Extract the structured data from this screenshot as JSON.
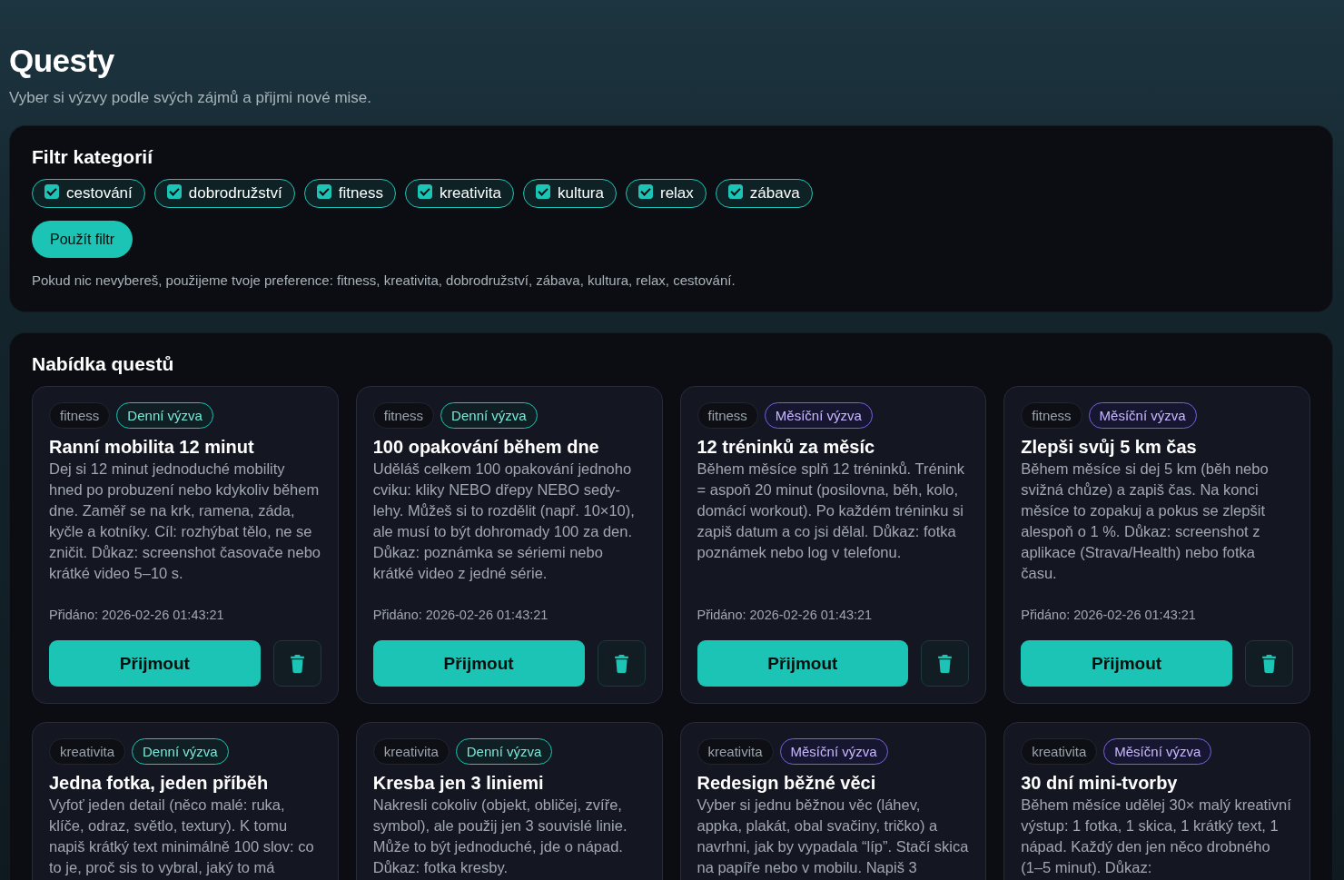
{
  "header": {
    "title": "Questy",
    "subtitle": "Vyber si výzvy podle svých zájmů a přijmi nové mise."
  },
  "filter": {
    "title": "Filtr kategorií",
    "categories": [
      {
        "label": "cestování",
        "checked": true
      },
      {
        "label": "dobrodružství",
        "checked": true
      },
      {
        "label": "fitness",
        "checked": true
      },
      {
        "label": "kreativita",
        "checked": true
      },
      {
        "label": "kultura",
        "checked": true
      },
      {
        "label": "relax",
        "checked": true
      },
      {
        "label": "zábava",
        "checked": true
      }
    ],
    "apply_button": "Použít filtr",
    "hint": "Pokud nic nevybereš, použijeme tvoje preference: fitness, kreativita, dobrodružství, zábava, kultura, relax, cestování."
  },
  "offers": {
    "title": "Nabídka questů",
    "quests": [
      {
        "category": "fitness",
        "type": {
          "label": "Denní výzva",
          "kind": "daily"
        },
        "title": "Ranní mobilita 12 minut",
        "description": "Dej si 12 minut jednoduché mobility hned po probuzení nebo kdykoliv během dne. Zaměř se na krk, ramena, záda, kyčle a kotníky. Cíl: rozhýbat tělo, ne se zničit. Důkaz: screenshot časovače nebo krátké video 5–10 s.",
        "added": "Přidáno: 2026-02-26 01:43:21",
        "accept": "Přijmout"
      },
      {
        "category": "fitness",
        "type": {
          "label": "Denní výzva",
          "kind": "daily"
        },
        "title": "100 opakování během dne",
        "description": "Uděláš celkem 100 opakování jednoho cviku: kliky NEBO dřepy NEBO sedy-lehy. Můžeš si to rozdělit (např. 10×10), ale musí to být dohromady 100 za den. Důkaz: poznámka se sériemi nebo krátké video z jedné série.",
        "added": "Přidáno: 2026-02-26 01:43:21",
        "accept": "Přijmout"
      },
      {
        "category": "fitness",
        "type": {
          "label": "Měsíční výzva",
          "kind": "monthly"
        },
        "title": "12 tréninků za měsíc",
        "description": "Během měsíce splň 12 tréninků. Trénink = aspoň 20 minut (posilovna, běh, kolo, domácí workout). Po každém tréninku si zapiš datum a co jsi dělal. Důkaz: fotka poznámek nebo log v telefonu.",
        "added": "Přidáno: 2026-02-26 01:43:21",
        "accept": "Přijmout"
      },
      {
        "category": "fitness",
        "type": {
          "label": "Měsíční výzva",
          "kind": "monthly"
        },
        "title": "Zlepši svůj 5 km čas",
        "description": "Během měsíce si dej 5 km (běh nebo svižná chůze) a zapiš čas. Na konci měsíce to zopakuj a pokus se zlepšit alespoň o 1 %. Důkaz: screenshot z aplikace (Strava/Health) nebo fotka času.",
        "added": "Přidáno: 2026-02-26 01:43:21",
        "accept": "Přijmout"
      },
      {
        "category": "kreativita",
        "type": {
          "label": "Denní výzva",
          "kind": "daily"
        },
        "title": "Jedna fotka, jeden příběh",
        "description": "Vyfoť jeden detail (něco malé: ruka, klíče, odraz, světlo, textury). K tomu napiš krátký text minimálně 100 slov: co to je, proč sis to vybral, jaký to má"
      },
      {
        "category": "kreativita",
        "type": {
          "label": "Denní výzva",
          "kind": "daily"
        },
        "title": "Kresba jen 3 liniemi",
        "description": "Nakresli cokoliv (objekt, obličej, zvíře, symbol), ale použij jen 3 souvislé linie. Může to být jednoduché, jde o nápad. Důkaz: fotka kresby."
      },
      {
        "category": "kreativita",
        "type": {
          "label": "Měsíční výzva",
          "kind": "monthly"
        },
        "title": "Redesign běžné věci",
        "description": "Vyber si jednu běžnou věc (láhev, appka, plakát, obal svačiny, tričko) a navrhni, jak by vypadala “líp”. Stačí skica na papíře nebo v mobilu. Napiš 3"
      },
      {
        "category": "kreativita",
        "type": {
          "label": "Měsíční výzva",
          "kind": "monthly"
        },
        "title": "30 dní mini-tvorby",
        "description": "Během měsíce udělej 30× malý kreativní výstup: 1 fotka, 1 skica, 1 krátký text, 1 nápad. Každý den jen něco drobného (1–5 minut). Důkaz:"
      }
    ]
  }
}
